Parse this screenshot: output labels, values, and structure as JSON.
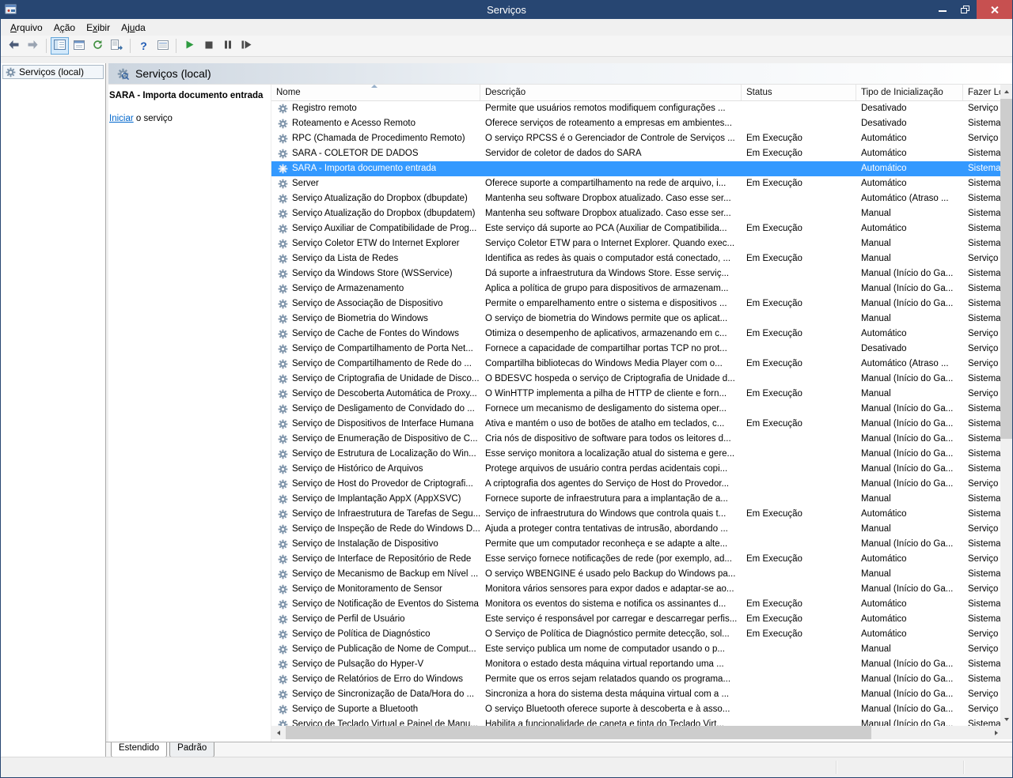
{
  "colors": {
    "titlebar": "#274672",
    "closebtn": "#c75050",
    "selection": "#3399ff",
    "link": "#0066cc"
  },
  "window": {
    "title": "Serviços"
  },
  "menu": {
    "items": [
      {
        "pre": "",
        "accel": "A",
        "post": "rquivo"
      },
      {
        "pre": "A",
        "accel": "ç",
        "post": "ão"
      },
      {
        "pre": "E",
        "accel": "x",
        "post": "ibir"
      },
      {
        "pre": "Aj",
        "accel": "u",
        "post": "da"
      }
    ]
  },
  "toolbar": {
    "help_glyph": "?",
    "icons": [
      "back-icon",
      "forward-icon",
      "show-console-tree-icon",
      "properties-icon",
      "refresh-icon",
      "export-list-icon",
      "help-icon",
      "view-icon",
      "start-service-icon",
      "stop-service-icon",
      "pause-service-icon",
      "restart-service-icon"
    ]
  },
  "tree": {
    "root": "Serviços (local)"
  },
  "banner": {
    "title": "Serviços (local)"
  },
  "extended_pane": {
    "selected_service": "SARA - Importa documento entrada",
    "action_link": "Iniciar",
    "action_suffix": " o serviço"
  },
  "table": {
    "columns": [
      "Nome",
      "Descrição",
      "Status",
      "Tipo de Inicialização",
      "Fazer Lo"
    ],
    "rows": [
      {
        "name": "Registro remoto",
        "desc": "Permite que usuários remotos modifiquem configurações ...",
        "status": "",
        "startup": "Desativado",
        "logon": "Serviço"
      },
      {
        "name": "Roteamento e Acesso Remoto",
        "desc": "Oferece serviços de roteamento a empresas em ambientes...",
        "status": "",
        "startup": "Desativado",
        "logon": "Sistema"
      },
      {
        "name": "RPC (Chamada de Procedimento Remoto)",
        "desc": "O serviço RPCSS é o Gerenciador de Controle de Serviços ...",
        "status": "Em Execução",
        "startup": "Automático",
        "logon": "Serviço"
      },
      {
        "name": "SARA - COLETOR DE DADOS",
        "desc": "Servidor de coletor de dados do SARA",
        "status": "Em Execução",
        "startup": "Automático",
        "logon": "Sistema"
      },
      {
        "name": "SARA - Importa documento entrada",
        "desc": "",
        "status": "",
        "startup": "Automático",
        "logon": "Sistema",
        "selected": true
      },
      {
        "name": "Server",
        "desc": "Oferece suporte a compartilhamento na rede de arquivo, i...",
        "status": "Em Execução",
        "startup": "Automático",
        "logon": "Sistema"
      },
      {
        "name": "Serviço Atualização do Dropbox (dbupdate)",
        "desc": "Mantenha seu software Dropbox atualizado. Caso esse ser...",
        "status": "",
        "startup": "Automático (Atraso ...",
        "logon": "Sistema"
      },
      {
        "name": "Serviço Atualização do Dropbox (dbupdatem)",
        "desc": "Mantenha seu software Dropbox atualizado. Caso esse ser...",
        "status": "",
        "startup": "Manual",
        "logon": "Sistema"
      },
      {
        "name": "Serviço Auxiliar de Compatibilidade de Prog...",
        "desc": "Este serviço dá suporte ao PCA (Auxiliar de Compatibilida...",
        "status": "Em Execução",
        "startup": "Automático",
        "logon": "Sistema"
      },
      {
        "name": "Serviço Coletor ETW do Internet Explorer",
        "desc": "Serviço Coletor ETW para o Internet Explorer. Quando exec...",
        "status": "",
        "startup": "Manual",
        "logon": "Sistema"
      },
      {
        "name": "Serviço da Lista de Redes",
        "desc": "Identifica as redes às quais o computador está conectado, ...",
        "status": "Em Execução",
        "startup": "Manual",
        "logon": "Serviço"
      },
      {
        "name": "Serviço da Windows Store (WSService)",
        "desc": "Dá suporte a  infraestrutura da Windows Store. Esse serviç...",
        "status": "",
        "startup": "Manual (Início do Ga...",
        "logon": "Sistema"
      },
      {
        "name": "Serviço de Armazenamento",
        "desc": "Aplica a política de grupo para dispositivos de armazenam...",
        "status": "",
        "startup": "Manual (Início do Ga...",
        "logon": "Sistema"
      },
      {
        "name": "Serviço de Associação de Dispositivo",
        "desc": "Permite o emparelhamento entre o sistema e dispositivos ...",
        "status": "Em Execução",
        "startup": "Manual (Início do Ga...",
        "logon": "Sistema"
      },
      {
        "name": "Serviço de Biometria do Windows",
        "desc": "O serviço de biometria do Windows permite que os aplicat...",
        "status": "",
        "startup": "Manual",
        "logon": "Sistema"
      },
      {
        "name": "Serviço de Cache de Fontes do Windows",
        "desc": "Otimiza o desempenho de aplicativos, armazenando em c...",
        "status": "Em Execução",
        "startup": "Automático",
        "logon": "Serviço"
      },
      {
        "name": "Serviço de Compartilhamento de Porta Net...",
        "desc": "Fornece a capacidade de compartilhar portas TCP no prot...",
        "status": "",
        "startup": "Desativado",
        "logon": "Serviço"
      },
      {
        "name": "Serviço de Compartilhamento de Rede do ...",
        "desc": "Compartilha bibliotecas do Windows Media Player com o...",
        "status": "Em Execução",
        "startup": "Automático (Atraso ...",
        "logon": "Serviço"
      },
      {
        "name": "Serviço de Criptografia de Unidade de Disco...",
        "desc": "O BDESVC hospeda o serviço de Criptografia de Unidade d...",
        "status": "",
        "startup": "Manual (Início do Ga...",
        "logon": "Sistema"
      },
      {
        "name": "Serviço de Descoberta Automática de Proxy...",
        "desc": "O WinHTTP implementa a pilha de HTTP de cliente e forn...",
        "status": "Em Execução",
        "startup": "Manual",
        "logon": "Serviço"
      },
      {
        "name": "Serviço de Desligamento de Convidado do ...",
        "desc": "Fornece um mecanismo de desligamento do sistema oper...",
        "status": "",
        "startup": "Manual (Início do Ga...",
        "logon": "Sistema"
      },
      {
        "name": "Serviço de Dispositivos de Interface Humana",
        "desc": "Ativa e mantém o uso de botões de atalho em teclados, c...",
        "status": "Em Execução",
        "startup": "Manual (Início do Ga...",
        "logon": "Sistema"
      },
      {
        "name": "Serviço de Enumeração de Dispositivo de C...",
        "desc": "Cria nós de dispositivo de software para todos os leitores d...",
        "status": "",
        "startup": "Manual (Início do Ga...",
        "logon": "Sistema"
      },
      {
        "name": "Serviço de Estrutura de Localização do Win...",
        "desc": "Esse serviço monitora a localização atual do sistema e gere...",
        "status": "",
        "startup": "Manual (Início do Ga...",
        "logon": "Sistema"
      },
      {
        "name": "Serviço de Histórico de Arquivos",
        "desc": "Protege arquivos de usuário contra perdas acidentais copi...",
        "status": "",
        "startup": "Manual (Início do Ga...",
        "logon": "Sistema"
      },
      {
        "name": "Serviço de Host do Provedor de Criptografi...",
        "desc": "A criptografia dos agentes do Serviço de Host do Provedor...",
        "status": "",
        "startup": "Manual (Início do Ga...",
        "logon": "Serviço"
      },
      {
        "name": "Serviço de Implantação AppX (AppXSVC)",
        "desc": "Fornece suporte de infraestrutura para a implantação de a...",
        "status": "",
        "startup": "Manual",
        "logon": "Sistema"
      },
      {
        "name": "Serviço de Infraestrutura de Tarefas de Segu...",
        "desc": "Serviço de infraestrutura do Windows que controla quais t...",
        "status": "Em Execução",
        "startup": "Automático",
        "logon": "Sistema"
      },
      {
        "name": "Serviço de Inspeção de Rede do Windows D...",
        "desc": "Ajuda a proteger contra tentativas de intrusão, abordando ...",
        "status": "",
        "startup": "Manual",
        "logon": "Serviço"
      },
      {
        "name": "Serviço de Instalação de Dispositivo",
        "desc": "Permite que um computador reconheça e se adapte a alte...",
        "status": "",
        "startup": "Manual (Início do Ga...",
        "logon": "Sistema"
      },
      {
        "name": "Serviço de Interface de Repositório de Rede",
        "desc": "Esse serviço fornece notificações de rede (por exemplo, ad...",
        "status": "Em Execução",
        "startup": "Automático",
        "logon": "Serviço"
      },
      {
        "name": "Serviço de Mecanismo de Backup em Nível ...",
        "desc": "O serviço WBENGINE é usado pelo Backup do Windows pa...",
        "status": "",
        "startup": "Manual",
        "logon": "Sistema"
      },
      {
        "name": "Serviço de Monitoramento de Sensor",
        "desc": "Monitora vários sensores para expor dados e adaptar-se ao...",
        "status": "",
        "startup": "Manual (Início do Ga...",
        "logon": "Serviço"
      },
      {
        "name": "Serviço de Notificação de Eventos do Sistema",
        "desc": "Monitora os eventos do sistema e notifica os assinantes d...",
        "status": "Em Execução",
        "startup": "Automático",
        "logon": "Sistema"
      },
      {
        "name": "Serviço de Perfil de Usuário",
        "desc": "Este serviço é responsável por carregar e descarregar perfis...",
        "status": "Em Execução",
        "startup": "Automático",
        "logon": "Sistema"
      },
      {
        "name": "Serviço de Política de Diagnóstico",
        "desc": "O Serviço de Política de Diagnóstico permite detecção, sol...",
        "status": "Em Execução",
        "startup": "Automático",
        "logon": "Serviço"
      },
      {
        "name": "Serviço de Publicação de Nome de Comput...",
        "desc": "Este serviço publica um nome de computador usando o p...",
        "status": "",
        "startup": "Manual",
        "logon": "Serviço"
      },
      {
        "name": "Serviço de Pulsação do Hyper-V",
        "desc": "Monitora o estado desta máquina virtual reportando uma ...",
        "status": "",
        "startup": "Manual (Início do Ga...",
        "logon": "Sistema"
      },
      {
        "name": "Serviço de Relatórios de Erro do Windows",
        "desc": "Permite que os erros sejam relatados quando os programa...",
        "status": "",
        "startup": "Manual (Início do Ga...",
        "logon": "Sistema"
      },
      {
        "name": "Serviço de Sincronização de Data/Hora do ...",
        "desc": "Sincroniza a hora do sistema desta máquina virtual com a ...",
        "status": "",
        "startup": "Manual (Início do Ga...",
        "logon": "Serviço"
      },
      {
        "name": "Serviço de Suporte a Bluetooth",
        "desc": "O serviço Bluetooth oferece suporte à descoberta e à asso...",
        "status": "",
        "startup": "Manual (Início do Ga...",
        "logon": "Serviço"
      },
      {
        "name": "Serviço de Teclado Virtual e Painel de Manu...",
        "desc": "Habilita a funcionalidade de caneta e tinta do Teclado Virt...",
        "status": "",
        "startup": "Manual (Início do Ga...",
        "logon": "Sistema"
      }
    ]
  },
  "tabs": [
    "Estendido",
    "Padrão"
  ]
}
